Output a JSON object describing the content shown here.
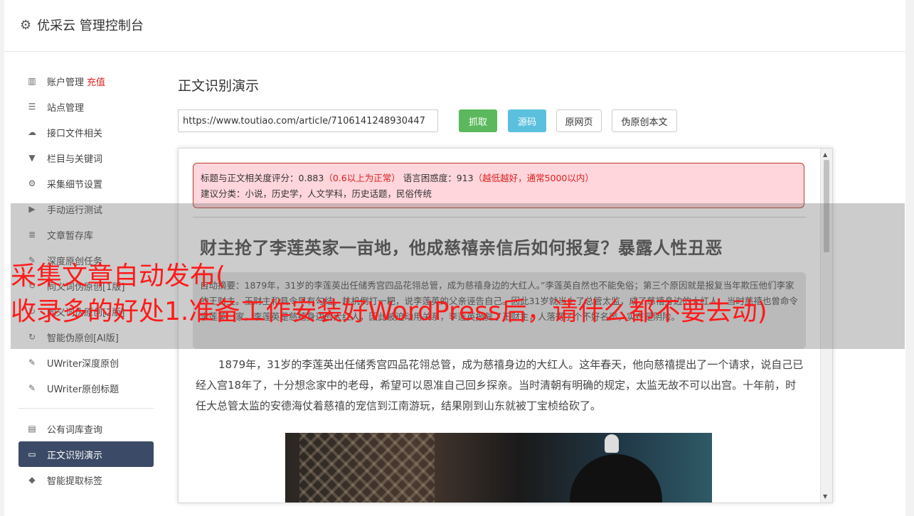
{
  "header": {
    "title": "优采云 管理控制台"
  },
  "sidebar": {
    "group1": [
      {
        "label": "账户管理",
        "tag": "充值",
        "icon": "bar-chart-icon"
      },
      {
        "label": "站点管理",
        "icon": "server-icon"
      },
      {
        "label": "接口文件相关",
        "icon": "cloud-upload-icon"
      },
      {
        "label": "栏目与关键词",
        "icon": "filter-icon"
      },
      {
        "label": "采集细节设置",
        "icon": "gears-icon"
      },
      {
        "label": "手动运行测试",
        "icon": "play-icon"
      },
      {
        "label": "文章暂存库",
        "icon": "database-icon"
      },
      {
        "label": "深度原创任务",
        "icon": "edit-icon"
      },
      {
        "label": "同义词伪原创[1版]",
        "icon": "refresh-icon"
      },
      {
        "label": "同义词伪原创[2版]",
        "icon": "refresh-icon"
      },
      {
        "label": "智能伪原创[AI版]",
        "icon": "refresh-icon"
      },
      {
        "label": "UWriter深度原创",
        "icon": "edit-icon"
      },
      {
        "label": "UWriter原创标题",
        "icon": "edit-icon"
      }
    ],
    "group2": [
      {
        "label": "公有词库查询",
        "icon": "book-icon"
      },
      {
        "label": "正文识别演示",
        "icon": "monitor-icon",
        "active": true
      },
      {
        "label": "智能提取标签",
        "icon": "tag-icon"
      }
    ]
  },
  "main": {
    "title": "正文识别演示",
    "url_value": "https://www.toutiao.com/article/7106141248930447",
    "buttons": {
      "fetch": "抓取",
      "source": "源码",
      "original": "原网页",
      "pseudo": "伪原创本文"
    }
  },
  "result": {
    "score_label": "标题与正文相关度评分：",
    "score_value": "0.883",
    "score_note": "（0.6以上为正常）",
    "perplexity_label": "语言困惑度：",
    "perplexity_value": "913",
    "perplexity_note": "（越低越好，通常5000以内）",
    "category_label": "建议分类：",
    "categories": "小说，历史学，人文学科，历史话题，民俗传统",
    "article_title": "财主抢了李莲英家一亩地，他成慈禧亲信后如何报复？暴露人性丑恶",
    "summary": "自动摘要：1879年，31岁的李莲英出任储秀宫四品花翎总管，成为慈禧身边的大红人。”李莲英自然也不能免俗；第三个原因就是报复当年欺压他们李家的王财主。王财主和县令早有勾结，趁机倒打一耙，说李莲英的父亲诬告自己。因此31岁就当上了总管太监，成了慈禧身边的大红人，当时慈禧也曾命令李莲英一家，李莲英是慈禧身边的大红人，因此被迫动用关系，李莲英报复了王财主，人落得了个不好名声，实在是阴险。",
    "paragraph": "1879年，31岁的李莲英出任储秀宫四品花翎总管，成为慈禧身边的大红人。这年春天，他向慈禧提出了一个请求，说自己已经入宫18年了，十分想念家中的老母，希望可以恩准自己回乡探亲。当时清朝有明确的规定，太监无故不可以出宫。十年前，时任大总管太监的安德海仗着慈禧的宠信到江南游玩，结果刚到山东就被丁宝桢给砍了。"
  },
  "overlay": {
    "line1": "采集文章自动发布(",
    "line2": "收录多的好处1.准备工作安装好WordPress后，请什么都不要去动)"
  }
}
